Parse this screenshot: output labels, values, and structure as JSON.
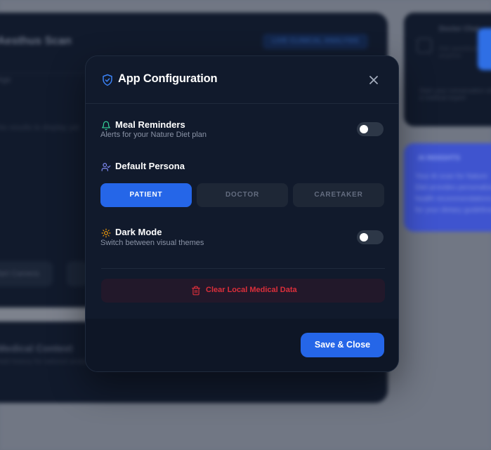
{
  "background": {
    "main_title": "Aesthus Scan",
    "main_pill": "LIVE CLINICAL ANALYSIS",
    "main_line": "Age",
    "main_hint": "No results to display yet",
    "main_button": "Start Camera",
    "main_footer_title": "Medical Context",
    "main_footer_sub": "Add history for tailored analysis",
    "right_title": "Doctor Chat",
    "right_sub": "Ask questions anytime",
    "right_note": "Start your conversation with a medical expert",
    "blue_title": "AI INSIGHTS",
    "blue_text": "Your AI scan for Nature Diet provides personalized health recommendations for your dietary guidelines."
  },
  "modal": {
    "title": "App Configuration",
    "meal": {
      "label": "Meal Reminders",
      "sub": "Alerts for your Nature Diet plan",
      "enabled": false
    },
    "persona": {
      "label": "Default Persona",
      "options": [
        "PATIENT",
        "DOCTOR",
        "CARETAKER"
      ],
      "selected": "PATIENT"
    },
    "dark_mode": {
      "label": "Dark Mode",
      "sub": "Switch between visual themes",
      "enabled": false
    },
    "clear_data_label": "Clear Local Medical Data",
    "save_label": "Save & Close"
  },
  "colors": {
    "accent": "#2566e8",
    "danger": "#dc2f3b",
    "bell_icon": "#34d399",
    "persona_icon": "#818cf8",
    "sun_icon": "#f59e0b",
    "shield_icon": "#3b82f6"
  },
  "icons": {
    "title": "shield-check-icon",
    "close": "close-icon",
    "meal": "bell-icon",
    "persona": "user-check-icon",
    "dark_mode": "sun-icon",
    "clear": "trash-icon"
  }
}
